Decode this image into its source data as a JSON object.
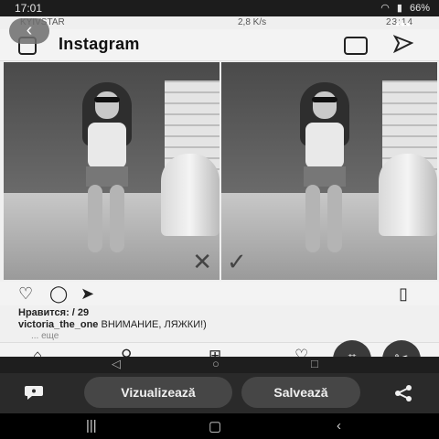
{
  "status": {
    "time": "17:01",
    "right_text": "66%"
  },
  "inner_status": {
    "carrier": "KYIVSTAR",
    "speed": "2,8 K/s",
    "time": "23:14"
  },
  "instagram": {
    "logo": "Instagram",
    "likes_label": "Нравится: / 29",
    "caption_user": "victoria_the_one",
    "caption_text": "ВНИМАНИЕ, ЛЯЖКИ!)",
    "more": "... еще"
  },
  "toolbar": {
    "visualize_label": "Vizualizează",
    "save_label": "Salvează"
  },
  "icons": {
    "back": "chevron-left-icon",
    "crop": "crop-icon",
    "scissors": "scissors-icon",
    "chat": "chat-icon",
    "share": "share-icon"
  }
}
